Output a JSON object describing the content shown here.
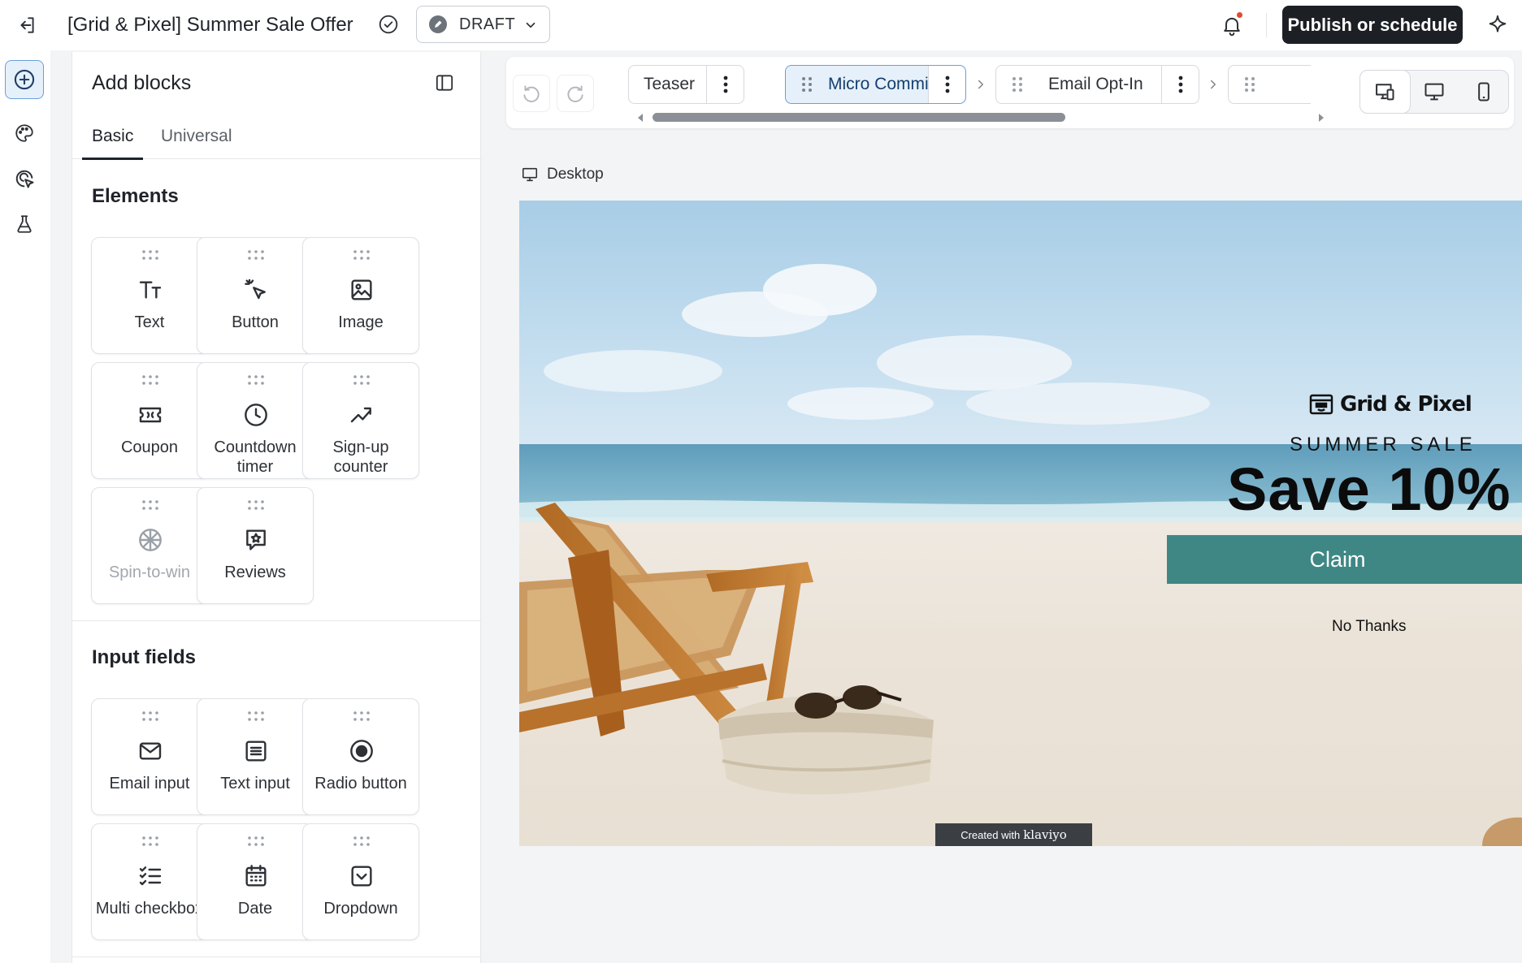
{
  "header": {
    "title": "[Grid & Pixel] Summer Sale Offer",
    "status": "DRAFT",
    "publish_label": "Publish or schedule"
  },
  "rail": {
    "items": [
      "add-blocks",
      "styles",
      "targeting",
      "experiments"
    ]
  },
  "panel": {
    "title": "Add blocks",
    "tabs": [
      "Basic",
      "Universal"
    ],
    "active_tab": "Basic",
    "sections": [
      {
        "title": "Elements",
        "blocks": [
          {
            "label": "Text",
            "icon": "text-icon"
          },
          {
            "label": "Button",
            "icon": "cursor-click-icon"
          },
          {
            "label": "Image",
            "icon": "image-icon"
          },
          {
            "label": "Coupon",
            "icon": "ticket-icon"
          },
          {
            "label": "Countdown timer",
            "icon": "clock-icon"
          },
          {
            "label": "Sign-up counter",
            "icon": "trend-up-icon"
          },
          {
            "label": "Spin-to-win",
            "icon": "wheel-icon",
            "disabled": true
          },
          {
            "label": "Reviews",
            "icon": "review-star-icon"
          }
        ]
      },
      {
        "title": "Input fields",
        "blocks": [
          {
            "label": "Email input",
            "icon": "envelope-icon"
          },
          {
            "label": "Text input",
            "icon": "text-field-icon"
          },
          {
            "label": "Radio button",
            "icon": "radio-icon"
          },
          {
            "label": "Multi checkbox",
            "icon": "checklist-icon"
          },
          {
            "label": "Date",
            "icon": "calendar-icon"
          },
          {
            "label": "Dropdown",
            "icon": "dropdown-icon"
          }
        ]
      }
    ]
  },
  "toolbar": {
    "steps": [
      {
        "label": "Teaser",
        "active": false
      },
      {
        "label": "Micro Commit",
        "active": true
      },
      {
        "label": "Email Opt-In",
        "active": false
      }
    ],
    "device_modes": [
      "both",
      "desktop",
      "mobile"
    ],
    "active_device": "both"
  },
  "canvas": {
    "view_label": "Desktop",
    "popup": {
      "brand": "Grid & Pixel",
      "subhead": "SUMMER SALE",
      "headline": "Save 10%",
      "cta": "Claim",
      "dismiss": "No Thanks",
      "badge_prefix": "Created with",
      "badge_brand": "klaviyo",
      "cta_color": "#3e8784"
    }
  },
  "colors": {
    "accent": "#6b9fd6",
    "primary_button": "#1c1f23",
    "notification_dot": "#e04a2f"
  }
}
